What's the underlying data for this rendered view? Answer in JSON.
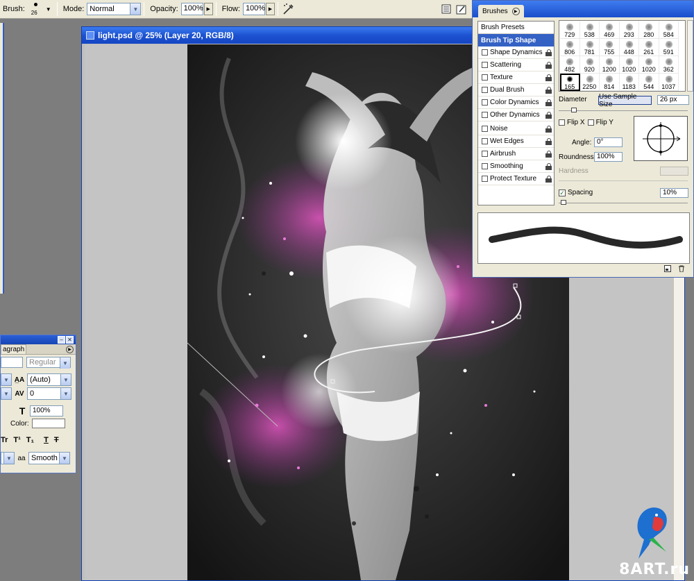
{
  "options_bar": {
    "brush_label": "Brush:",
    "brush_size": "26",
    "mode_label": "Mode:",
    "mode_value": "Normal",
    "opacity_label": "Opacity:",
    "opacity_value": "100%",
    "flow_label": "Flow:",
    "flow_value": "100%"
  },
  "document": {
    "title": "light.psd @ 25% (Layer 20, RGB/8)"
  },
  "character_panel": {
    "tab_label": "agraph",
    "font_style": "Regular",
    "leading": "(Auto)",
    "tracking": "0",
    "horizontal_scale": "100%",
    "color_label": "Color:",
    "antialias": "Smooth",
    "aa_icon_text": "aa",
    "style_buttons": [
      "Tr",
      "T¹",
      "T₁",
      "T",
      "T"
    ]
  },
  "brushes_panel": {
    "tab_label": "Brushes",
    "presets_label": "Brush Presets",
    "tip_shape_label": "Brush Tip Shape",
    "options": [
      {
        "label": "Shape Dynamics",
        "checked": false
      },
      {
        "label": "Scattering",
        "checked": false
      },
      {
        "label": "Texture",
        "checked": false
      },
      {
        "label": "Dual Brush",
        "checked": false
      },
      {
        "label": "Color Dynamics",
        "checked": false
      },
      {
        "label": "Other Dynamics",
        "checked": false
      },
      {
        "label": "Noise",
        "checked": false
      },
      {
        "label": "Wet Edges",
        "checked": false
      },
      {
        "label": "Airbrush",
        "checked": false
      },
      {
        "label": "Smoothing",
        "checked": false
      },
      {
        "label": "Protect Texture",
        "checked": false
      }
    ],
    "brush_sizes": [
      "729",
      "538",
      "469",
      "293",
      "280",
      "584",
      "806",
      "781",
      "755",
      "448",
      "261",
      "591",
      "482",
      "920",
      "1200",
      "1020",
      "1020",
      "362",
      "165",
      "2250",
      "814",
      "1183",
      "544",
      "1037"
    ],
    "selected_brush_index": 18,
    "diameter_label": "Diameter",
    "use_sample_size": "Use Sample Size",
    "diameter_value": "26 px",
    "flip_x_label": "Flip X",
    "flip_y_label": "Flip Y",
    "angle_label": "Angle:",
    "angle_value": "0°",
    "roundness_label": "Roundness:",
    "roundness_value": "100%",
    "hardness_label": "Hardness",
    "spacing_label": "Spacing",
    "spacing_value": "10%",
    "spacing_checked": true
  },
  "watermark": "8ART.ru",
  "colors": {
    "accent_blue": "#1c52d0",
    "panel_bg": "#ece9d8",
    "workspace": "#7d7d7d",
    "artwork_pink": "#c23c9a"
  }
}
